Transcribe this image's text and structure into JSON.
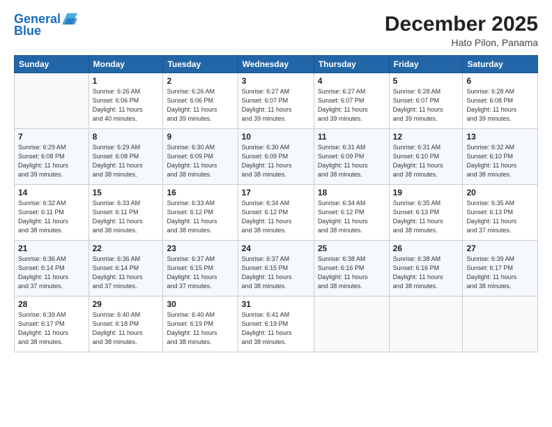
{
  "header": {
    "logo_line1": "General",
    "logo_line2": "Blue",
    "month": "December 2025",
    "location": "Hato Pilon, Panama"
  },
  "days_of_week": [
    "Sunday",
    "Monday",
    "Tuesday",
    "Wednesday",
    "Thursday",
    "Friday",
    "Saturday"
  ],
  "weeks": [
    [
      {
        "num": "",
        "info": ""
      },
      {
        "num": "1",
        "info": "Sunrise: 6:26 AM\nSunset: 6:06 PM\nDaylight: 11 hours\nand 40 minutes."
      },
      {
        "num": "2",
        "info": "Sunrise: 6:26 AM\nSunset: 6:06 PM\nDaylight: 11 hours\nand 39 minutes."
      },
      {
        "num": "3",
        "info": "Sunrise: 6:27 AM\nSunset: 6:07 PM\nDaylight: 11 hours\nand 39 minutes."
      },
      {
        "num": "4",
        "info": "Sunrise: 6:27 AM\nSunset: 6:07 PM\nDaylight: 11 hours\nand 39 minutes."
      },
      {
        "num": "5",
        "info": "Sunrise: 6:28 AM\nSunset: 6:07 PM\nDaylight: 11 hours\nand 39 minutes."
      },
      {
        "num": "6",
        "info": "Sunrise: 6:28 AM\nSunset: 6:08 PM\nDaylight: 11 hours\nand 39 minutes."
      }
    ],
    [
      {
        "num": "7",
        "info": "Sunrise: 6:29 AM\nSunset: 6:08 PM\nDaylight: 11 hours\nand 39 minutes."
      },
      {
        "num": "8",
        "info": "Sunrise: 6:29 AM\nSunset: 6:08 PM\nDaylight: 11 hours\nand 38 minutes."
      },
      {
        "num": "9",
        "info": "Sunrise: 6:30 AM\nSunset: 6:09 PM\nDaylight: 11 hours\nand 38 minutes."
      },
      {
        "num": "10",
        "info": "Sunrise: 6:30 AM\nSunset: 6:09 PM\nDaylight: 11 hours\nand 38 minutes."
      },
      {
        "num": "11",
        "info": "Sunrise: 6:31 AM\nSunset: 6:09 PM\nDaylight: 11 hours\nand 38 minutes."
      },
      {
        "num": "12",
        "info": "Sunrise: 6:31 AM\nSunset: 6:10 PM\nDaylight: 11 hours\nand 38 minutes."
      },
      {
        "num": "13",
        "info": "Sunrise: 6:32 AM\nSunset: 6:10 PM\nDaylight: 11 hours\nand 38 minutes."
      }
    ],
    [
      {
        "num": "14",
        "info": "Sunrise: 6:32 AM\nSunset: 6:11 PM\nDaylight: 11 hours\nand 38 minutes."
      },
      {
        "num": "15",
        "info": "Sunrise: 6:33 AM\nSunset: 6:11 PM\nDaylight: 11 hours\nand 38 minutes."
      },
      {
        "num": "16",
        "info": "Sunrise: 6:33 AM\nSunset: 6:12 PM\nDaylight: 11 hours\nand 38 minutes."
      },
      {
        "num": "17",
        "info": "Sunrise: 6:34 AM\nSunset: 6:12 PM\nDaylight: 11 hours\nand 38 minutes."
      },
      {
        "num": "18",
        "info": "Sunrise: 6:34 AM\nSunset: 6:12 PM\nDaylight: 11 hours\nand 38 minutes."
      },
      {
        "num": "19",
        "info": "Sunrise: 6:35 AM\nSunset: 6:13 PM\nDaylight: 11 hours\nand 38 minutes."
      },
      {
        "num": "20",
        "info": "Sunrise: 6:35 AM\nSunset: 6:13 PM\nDaylight: 11 hours\nand 37 minutes."
      }
    ],
    [
      {
        "num": "21",
        "info": "Sunrise: 6:36 AM\nSunset: 6:14 PM\nDaylight: 11 hours\nand 37 minutes."
      },
      {
        "num": "22",
        "info": "Sunrise: 6:36 AM\nSunset: 6:14 PM\nDaylight: 11 hours\nand 37 minutes."
      },
      {
        "num": "23",
        "info": "Sunrise: 6:37 AM\nSunset: 6:15 PM\nDaylight: 11 hours\nand 37 minutes."
      },
      {
        "num": "24",
        "info": "Sunrise: 6:37 AM\nSunset: 6:15 PM\nDaylight: 11 hours\nand 38 minutes."
      },
      {
        "num": "25",
        "info": "Sunrise: 6:38 AM\nSunset: 6:16 PM\nDaylight: 11 hours\nand 38 minutes."
      },
      {
        "num": "26",
        "info": "Sunrise: 6:38 AM\nSunset: 6:16 PM\nDaylight: 11 hours\nand 38 minutes."
      },
      {
        "num": "27",
        "info": "Sunrise: 6:39 AM\nSunset: 6:17 PM\nDaylight: 11 hours\nand 38 minutes."
      }
    ],
    [
      {
        "num": "28",
        "info": "Sunrise: 6:39 AM\nSunset: 6:17 PM\nDaylight: 11 hours\nand 38 minutes."
      },
      {
        "num": "29",
        "info": "Sunrise: 6:40 AM\nSunset: 6:18 PM\nDaylight: 11 hours\nand 38 minutes."
      },
      {
        "num": "30",
        "info": "Sunrise: 6:40 AM\nSunset: 6:19 PM\nDaylight: 11 hours\nand 38 minutes."
      },
      {
        "num": "31",
        "info": "Sunrise: 6:41 AM\nSunset: 6:19 PM\nDaylight: 11 hours\nand 38 minutes."
      },
      {
        "num": "",
        "info": ""
      },
      {
        "num": "",
        "info": ""
      },
      {
        "num": "",
        "info": ""
      }
    ]
  ]
}
